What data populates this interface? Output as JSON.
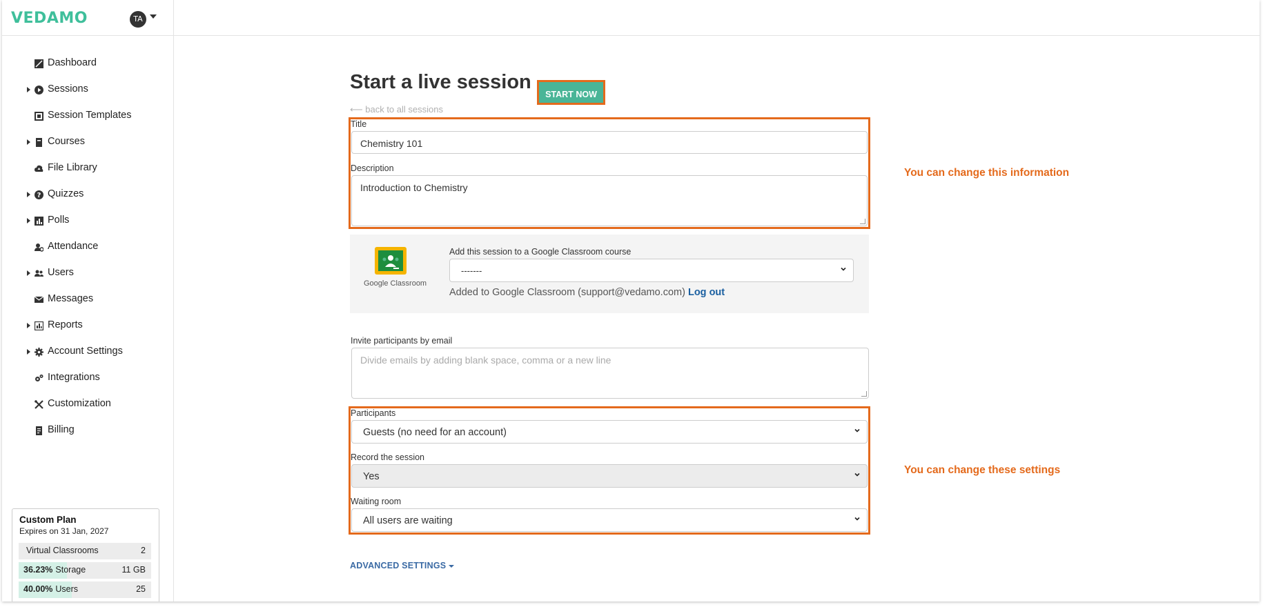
{
  "brand": {
    "logo_text": "VEDAMO",
    "avatar_initials": "TA",
    "accent_color": "#4ab597",
    "highlight_color": "#e46a1c"
  },
  "sidebar": {
    "items": [
      {
        "label": "Dashboard",
        "icon": "dashboard-icon",
        "expandable": false
      },
      {
        "label": "Sessions",
        "icon": "play-circle-icon",
        "expandable": true
      },
      {
        "label": "Session Templates",
        "icon": "template-icon",
        "expandable": false
      },
      {
        "label": "Courses",
        "icon": "book-icon",
        "expandable": true
      },
      {
        "label": "File Library",
        "icon": "cloud-upload-icon",
        "expandable": false
      },
      {
        "label": "Quizzes",
        "icon": "question-circle-icon",
        "expandable": true
      },
      {
        "label": "Polls",
        "icon": "poll-icon",
        "expandable": true
      },
      {
        "label": "Attendance",
        "icon": "user-check-icon",
        "expandable": false
      },
      {
        "label": "Users",
        "icon": "users-icon",
        "expandable": true
      },
      {
        "label": "Messages",
        "icon": "envelope-icon",
        "expandable": false
      },
      {
        "label": "Reports",
        "icon": "chart-icon",
        "expandable": true
      },
      {
        "label": "Account Settings",
        "icon": "gear-icon",
        "expandable": true
      },
      {
        "label": "Integrations",
        "icon": "cogs-icon",
        "expandable": false
      },
      {
        "label": "Customization",
        "icon": "tools-icon",
        "expandable": false
      },
      {
        "label": "Billing",
        "icon": "receipt-icon",
        "expandable": false
      }
    ]
  },
  "plan": {
    "name": "Custom Plan",
    "expires": "Expires on 31 Jan, 2027",
    "rows": [
      {
        "percent_text": "",
        "label": "Virtual Classrooms",
        "value": "2",
        "fill": 0
      },
      {
        "percent_text": "36.23%",
        "label": "Storage",
        "value": "11 GB",
        "fill": 0.3623
      },
      {
        "percent_text": "40.00%",
        "label": "Users",
        "value": "25",
        "fill": 0.4
      }
    ]
  },
  "main": {
    "title": "Start a live session",
    "start_button": "START NOW",
    "back_link": "⟵ back to all sessions",
    "title_label": "Title",
    "title_value": "Chemistry 101",
    "description_label": "Description",
    "description_value": "Introduction to Chemistry",
    "google_classroom": {
      "logo_caption": "Google Classroom",
      "add_label": "Add this session to a Google Classroom course",
      "select_value": "-------",
      "status_text": "Added to Google Classroom (support@vedamo.com)",
      "logout_label": "Log out"
    },
    "invite_label": "Invite participants by email",
    "invite_placeholder": "Divide emails by adding blank space, comma or a new line",
    "participants_label": "Participants",
    "participants_value": "Guests (no need for an account)",
    "record_label": "Record the session",
    "record_value": "Yes",
    "waiting_label": "Waiting room",
    "waiting_value": "All users are waiting",
    "advanced_settings": "ADVANCED SETTINGS"
  },
  "annotations": {
    "info": "You can change this information",
    "settings": "You can change these settings"
  }
}
